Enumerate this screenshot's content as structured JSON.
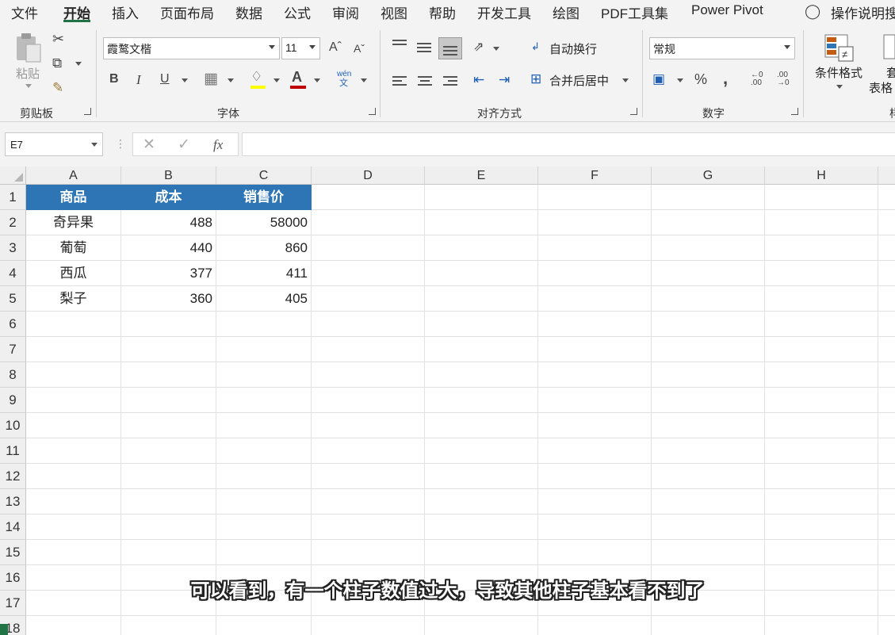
{
  "menu": {
    "tabs": [
      "文件",
      "开始",
      "插入",
      "页面布局",
      "数据",
      "公式",
      "审阅",
      "视图",
      "帮助",
      "开发工具",
      "绘图",
      "PDF工具集",
      "Power Pivot"
    ],
    "active_tab": "开始",
    "tell_me": "操作说明搜"
  },
  "ribbon": {
    "clipboard": {
      "paste_label": "粘贴",
      "group_label": "剪贴板"
    },
    "font": {
      "font_name": "霞鹜文楷",
      "font_size": "11",
      "group_label": "字体",
      "bold": "B",
      "italic": "I",
      "underline": "U",
      "phonetic": "wén"
    },
    "alignment": {
      "wrap_text": "自动换行",
      "merge_center": "合并后居中",
      "group_label": "对齐方式"
    },
    "number": {
      "format": "常规",
      "percent": "%",
      "comma": ",",
      "group_label": "数字"
    },
    "styles": {
      "conditional_format": "条件格式",
      "table_format_partial_1": "套",
      "table_format_partial_2": "表格",
      "group_label_partial": "样"
    }
  },
  "formula_bar": {
    "name_box": "E7",
    "value": "",
    "fx": "fx"
  },
  "sheet": {
    "columns": [
      "A",
      "B",
      "C",
      "D",
      "E",
      "F",
      "G",
      "H"
    ],
    "rows": [
      "1",
      "2",
      "3",
      "4",
      "5",
      "6",
      "7",
      "8",
      "9",
      "10",
      "11",
      "12",
      "13",
      "14",
      "15",
      "16",
      "17",
      "18"
    ],
    "headers": [
      "商品",
      "成本",
      "销售价"
    ],
    "data": [
      [
        "奇异果",
        "488",
        "58000"
      ],
      [
        "葡萄",
        "440",
        "860"
      ],
      [
        "西瓜",
        "377",
        "411"
      ],
      [
        "梨子",
        "360",
        "405"
      ]
    ]
  },
  "subtitle": "可以看到，有一个柱子数值过大，导致其他柱子基本看不到了",
  "colors": {
    "header_fill": "#2e75b6",
    "excel_green": "#217346"
  }
}
